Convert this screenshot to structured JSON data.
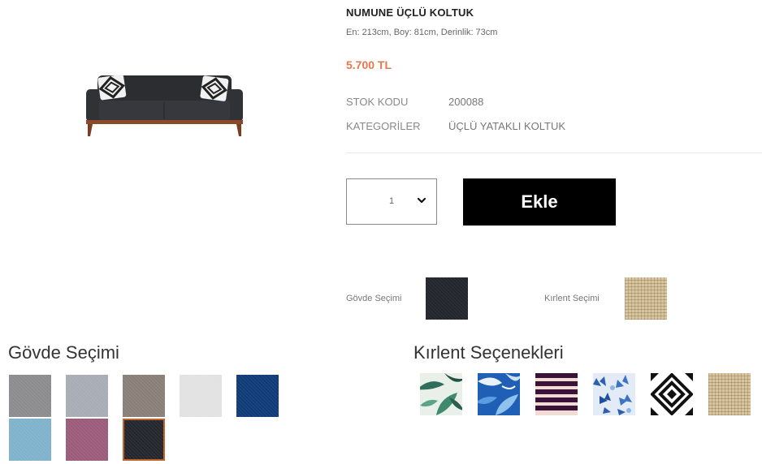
{
  "product": {
    "title": "NUMUNE ÜÇLÜ KOLTUK",
    "dimensions": "En: 213cm, Boy: 81cm, Derinlik: 73cm",
    "price": "5.700 TL",
    "meta": [
      {
        "label": "STOK KODU",
        "value": "200088"
      },
      {
        "label": "KATEGORİLER",
        "value": "ÜÇLÜ YATAKLI KOLTUK"
      }
    ]
  },
  "cart": {
    "quantity": "1",
    "add_label": "Ekle"
  },
  "selection": {
    "body_label": "Gövde Seçimi",
    "pillow_label": "Kırlent Seçimi"
  },
  "body_options": {
    "title": "Gövde Seçimi",
    "colors": [
      "#8c8c8e",
      "#a8acb4",
      "#8a7f78",
      "#e2e2e2",
      "#0f3a78",
      "#7fb3cc",
      "#9b5b7a",
      "#23262d"
    ],
    "selected_index": 7
  },
  "pillow_options": {
    "title": "Kırlent Seçenekleri",
    "patterns": [
      "green-leaf-pattern",
      "blue-leaf-pattern",
      "stripe-pattern",
      "blue-floral-pattern",
      "black-diamond-pattern",
      "beige-linen-pattern"
    ]
  },
  "colors": {
    "price": "#e8774a",
    "button": "#000000",
    "selected_border": "#c0642a"
  }
}
